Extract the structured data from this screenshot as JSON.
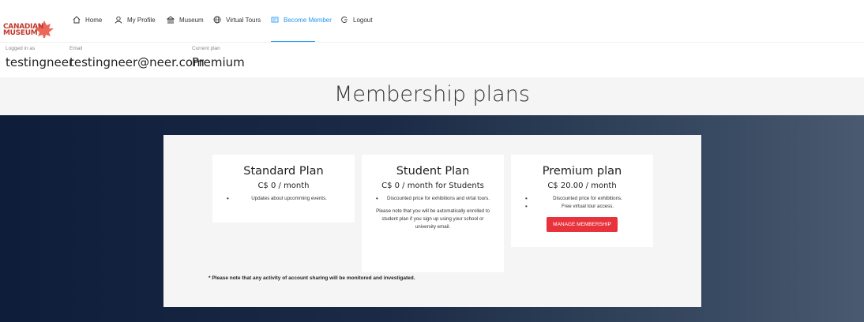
{
  "logo": {
    "line1": "CANADIAN",
    "line2": "MUSEUM"
  },
  "nav": {
    "items": [
      {
        "label": "Home",
        "icon": "home-icon"
      },
      {
        "label": "My Profile",
        "icon": "user-icon"
      },
      {
        "label": "Museum",
        "icon": "museum-icon"
      },
      {
        "label": "Virtual Tours",
        "icon": "globe-icon"
      },
      {
        "label": "Become Member",
        "icon": "id-card-icon"
      },
      {
        "label": "Logout",
        "icon": "logout-icon"
      }
    ],
    "active": "Become Member"
  },
  "user": {
    "logged_label": "Logged in as",
    "logged_value": "testingneer",
    "email_label": "Email",
    "email_value": "testingneer@neer.com",
    "plan_label": "Current plan",
    "plan_value": "Premium"
  },
  "page": {
    "title": "Membership plans"
  },
  "plans": [
    {
      "name": "Standard Plan",
      "price": "C$ 0 / month",
      "features": [
        "Updates about upcomming events."
      ]
    },
    {
      "name": "Student Plan",
      "price": "C$ 0 / month for Students",
      "features": [
        "Discounted price for exhibitions and virtal tours."
      ],
      "note": "Please note that you will be automatically enrolled to student plan if you sign up using your school or university email."
    },
    {
      "name": "Premium plan",
      "price": "C$ 20.00 / month",
      "features": [
        "Discounted price for exhibitions.",
        "Free virtual tour access."
      ],
      "button": "MANAGE MEMBERSHIP"
    }
  ],
  "footnote": "* Please note that any activity of account sharing will be monitored and investigated.",
  "colors": {
    "accent": "#2196f3",
    "button": "#e8323c",
    "hero_dark": "#0e1e3a",
    "hero_light": "#4a5a70"
  }
}
